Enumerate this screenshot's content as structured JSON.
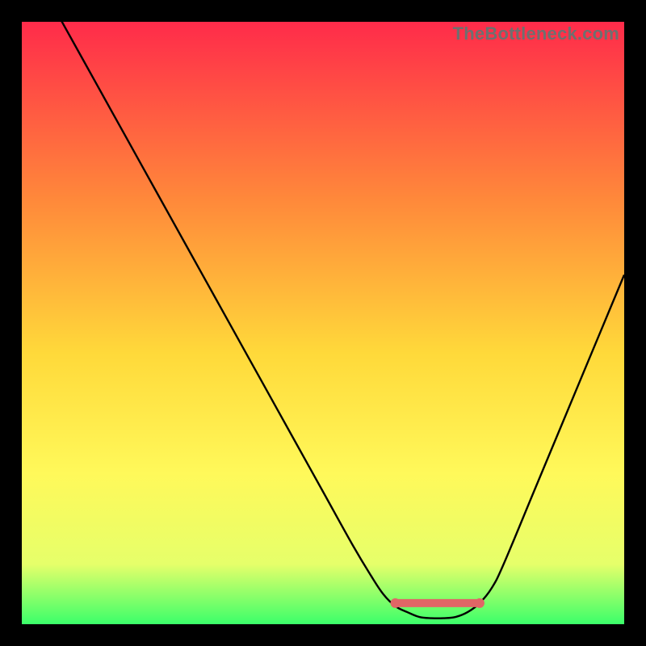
{
  "watermark": "TheBottleneck.com",
  "colors": {
    "grad_top": "#ff2b4a",
    "grad_mid_upper": "#ff8a3a",
    "grad_mid": "#ffd93a",
    "grad_mid_lower": "#fff95a",
    "grad_lower": "#e6ff6a",
    "grad_bottom": "#3bff6a",
    "curve": "#000000",
    "marker_stroke": "#e06666",
    "marker_fill": "#e06666",
    "frame": "#000000"
  },
  "chart_data": {
    "type": "line",
    "title": "",
    "xlabel": "",
    "ylabel": "",
    "xlim": [
      0,
      100
    ],
    "ylim": [
      0,
      100
    ],
    "series": [
      {
        "name": "bottleneck-curve",
        "x": [
          0,
          5,
          10,
          15,
          20,
          25,
          30,
          35,
          40,
          45,
          50,
          55,
          58,
          60,
          62,
          64,
          66,
          68,
          70,
          72,
          74,
          76,
          78,
          80,
          85,
          90,
          95,
          100
        ],
        "y": [
          112,
          103,
          94,
          85,
          76,
          67,
          58,
          49,
          40,
          31,
          22,
          13,
          8,
          5,
          3,
          2,
          1.2,
          1,
          1,
          1.2,
          2,
          3.5,
          6,
          10,
          22,
          34,
          46,
          58
        ]
      }
    ],
    "markers": [
      {
        "name": "optimal-segment-start",
        "x": 62,
        "y": 3.5
      },
      {
        "name": "optimal-segment-end",
        "x": 76,
        "y": 3.5
      }
    ],
    "optimal_band": {
      "x0": 62,
      "x1": 76,
      "y": 3.5
    }
  }
}
